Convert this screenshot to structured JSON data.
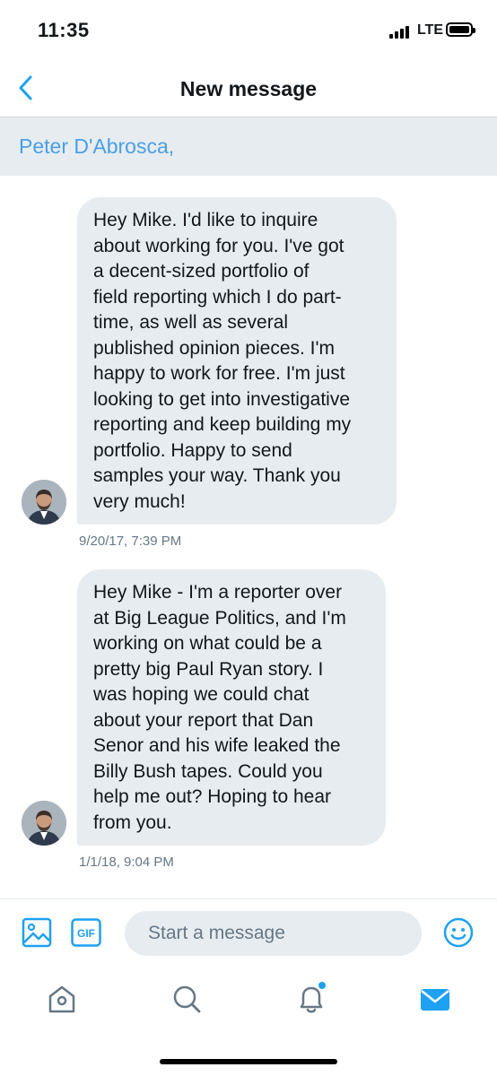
{
  "status": {
    "time": "11:35",
    "network": "LTE"
  },
  "nav": {
    "title": "New message"
  },
  "recipient": {
    "text": "Peter D'Abrosca,"
  },
  "messages": [
    {
      "lines": [
        "Hey Mike. I'd like to inquire",
        "about working for you. I've got",
        "a decent-sized portfolio of",
        "field reporting which I do part-",
        "time, as well as several",
        "published opinion pieces. I'm",
        "happy to work for free. I'm just",
        "looking to get into investigative",
        "reporting and keep building my",
        "portfolio. Happy to send",
        "samples your way. Thank you",
        "very much!"
      ],
      "timestamp": "9/20/17, 7:39 PM"
    },
    {
      "lines": [
        "Hey Mike - I'm a reporter over",
        "at Big League Politics, and I'm",
        "working on what could be a",
        "pretty big Paul Ryan story. I",
        "was hoping we could chat",
        "about your report that Dan",
        "Senor and his wife leaked the",
        "Billy Bush tapes. Could you",
        "help me out? Hoping to hear",
        "from you."
      ],
      "timestamp": "1/1/18, 9:04 PM"
    }
  ],
  "composer": {
    "placeholder": "Start a message",
    "gif_label": "GIF",
    "icons": [
      "image-icon",
      "gif-icon",
      "emoji-icon"
    ]
  },
  "tabs": [
    "home-icon",
    "search-icon",
    "notifications-icon",
    "messages-icon"
  ],
  "colors": {
    "accent": "#1da1f2",
    "recipient": "#4a9fe5",
    "bubble": "#e6ecf0",
    "muted": "#657786"
  }
}
